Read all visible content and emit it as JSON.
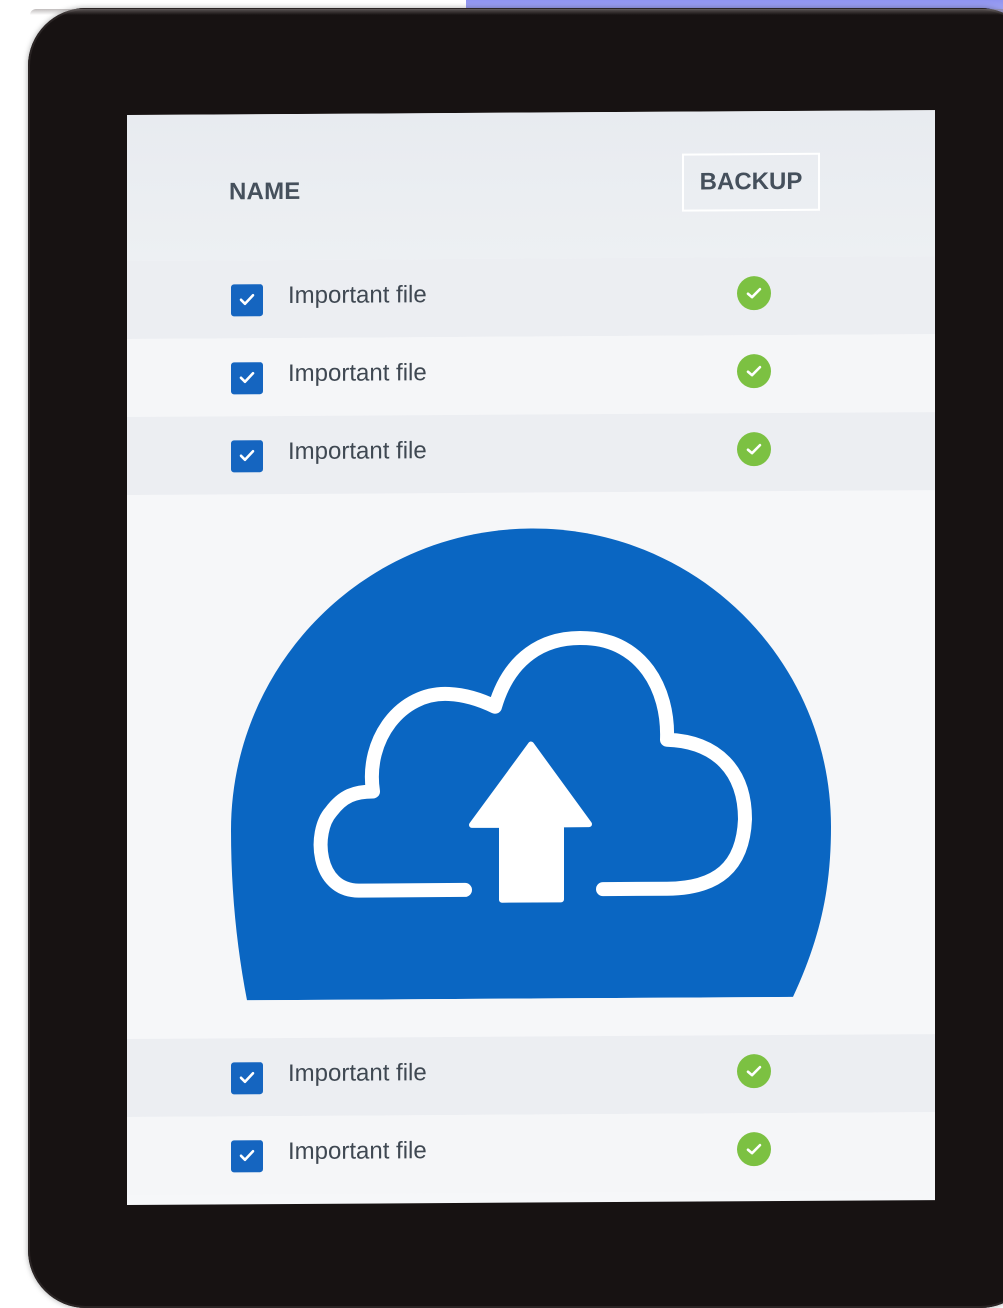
{
  "table": {
    "name_header": "NAME",
    "backup_header": "BACKUP",
    "rows": [
      {
        "label": "Important file",
        "checked": true,
        "backup_status": "done"
      },
      {
        "label": "Important file",
        "checked": true,
        "backup_status": "done"
      },
      {
        "label": "Important file",
        "checked": true,
        "backup_status": "done"
      },
      {
        "label": "Important file",
        "checked": true,
        "backup_status": "done"
      },
      {
        "label": "Important file",
        "checked": true,
        "backup_status": "done"
      }
    ]
  },
  "icons": {
    "checkbox": "checkbox-checked-icon",
    "status": "check-circle-icon",
    "hero": "cloud-upload-icon"
  },
  "colors": {
    "accent_blue": "#1565c0",
    "success_green": "#7cc142",
    "header_text": "#45505c",
    "device_frame": "#171212"
  }
}
